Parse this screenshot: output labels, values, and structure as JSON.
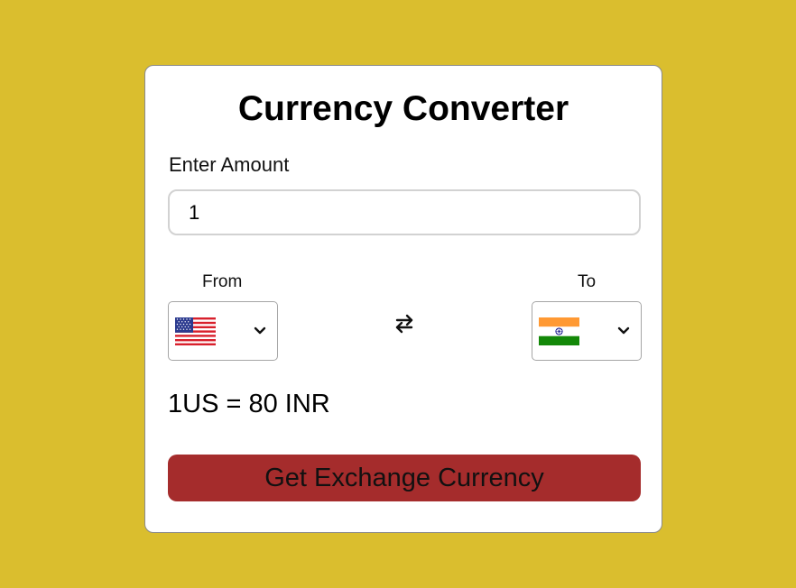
{
  "app": {
    "title": "Currency Converter"
  },
  "amount": {
    "label": "Enter Amount",
    "value": "1"
  },
  "from": {
    "label": "From",
    "currency_flag": "us-flag-icon"
  },
  "to": {
    "label": "To",
    "currency_flag": "india-flag-icon"
  },
  "swap": {
    "icon": "swap-arrows-icon"
  },
  "rate": {
    "text": "1US = 80 INR"
  },
  "actions": {
    "exchange_label": "Get Exchange Currency"
  },
  "colors": {
    "background": "#dabe2e",
    "button": "#a52c2c",
    "card": "#ffffff"
  }
}
